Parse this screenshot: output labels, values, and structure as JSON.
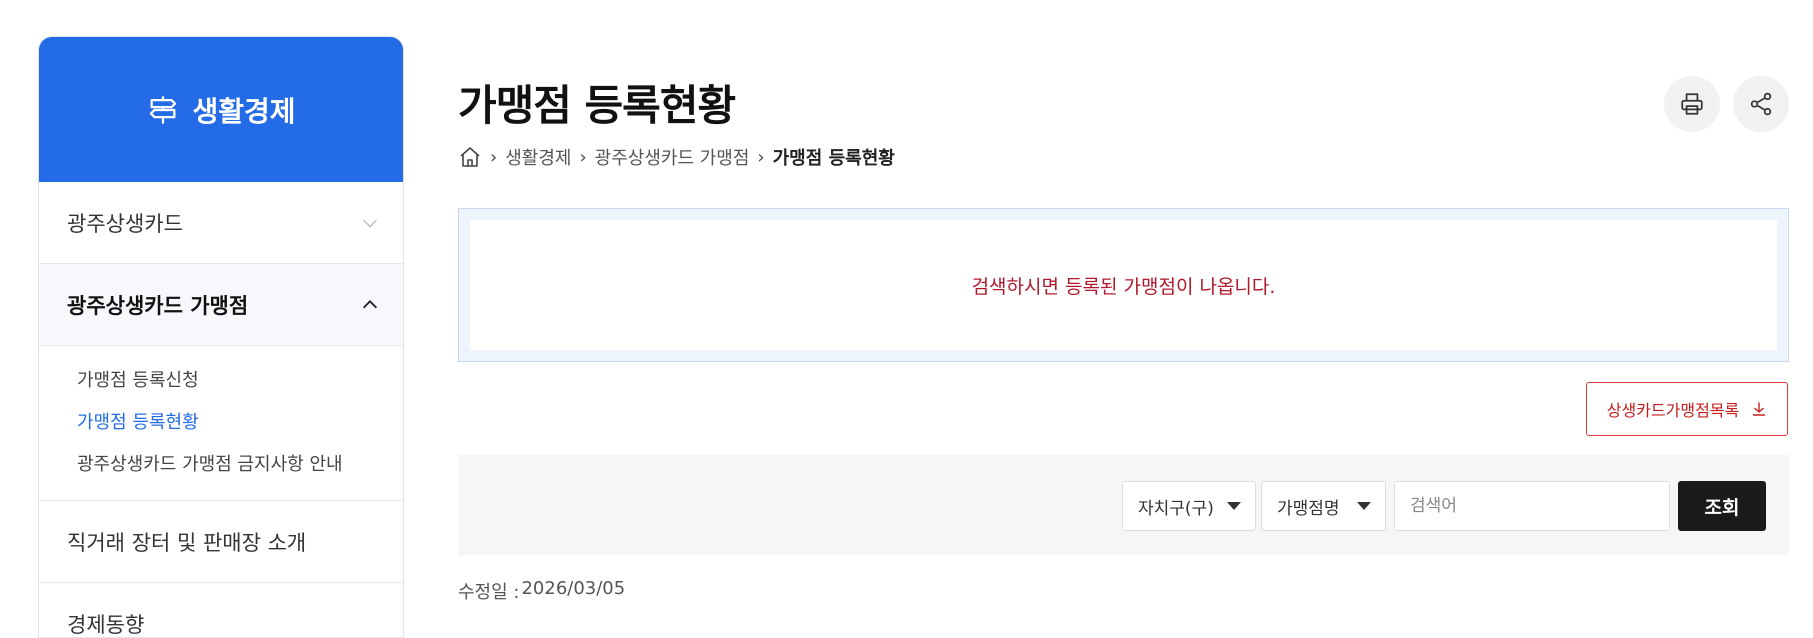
{
  "sidebar": {
    "title": "생활경제",
    "title_icon": "signpost-icon",
    "header_color": "#246be8",
    "items": [
      {
        "label": "광주상생카드",
        "state": "collapsed"
      },
      {
        "label": "광주상생카드 가맹점",
        "state": "expanded"
      },
      {
        "label": "직거래 장터 및 판매장 소개",
        "state": "none"
      },
      {
        "label": "경제동향",
        "state": "none"
      }
    ],
    "submenu": [
      {
        "label": "가맹점 등록신청"
      },
      {
        "label": "가맹점 등록현황",
        "current": true
      },
      {
        "label": "광주상생카드 가맹점 금지사항 안내"
      }
    ]
  },
  "page": {
    "title": "가맹점 등록현황",
    "print_icon": "print-icon",
    "share_icon": "share-icon"
  },
  "breadcrumb": {
    "home_icon": "home-icon",
    "items": [
      "생활경제",
      "광주상생카드 가맹점",
      "가맹점 등록현황"
    ]
  },
  "notice": {
    "text": "검색하시면 등록된 가맹점이 나옵니다.",
    "color": "#b1182b"
  },
  "download": {
    "label": "상생카드가맹점목록",
    "icon": "download-icon"
  },
  "search": {
    "district_select": "자치구(구)",
    "field_select": "가맹점명",
    "input_value": "",
    "input_placeholder": "검색어",
    "button_label": "조회"
  },
  "modified": {
    "label": "수정일 :",
    "date": "2026/03/05"
  }
}
